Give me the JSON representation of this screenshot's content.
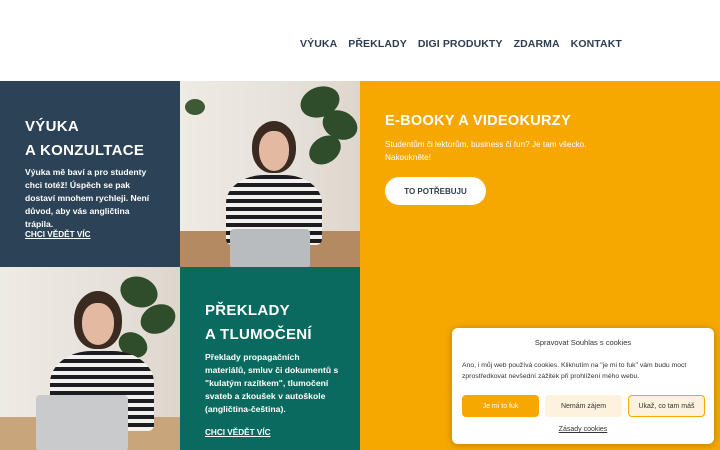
{
  "nav": {
    "items": [
      "VÝUKA",
      "PŘEKLADY",
      "DIGI PRODUKTY",
      "ZDARMA",
      "KONTAKT"
    ]
  },
  "tiles": {
    "teaching": {
      "title_line1": "VÝUKA",
      "title_line2": "A KONZULTACE",
      "text": "Výuka mě baví a pro studenty chci totéž! Úspěch se pak dostaví mnohem rychleji. Není důvod, aby vás angličtina trápila.",
      "link": "CHCI VĚDĚT VÍC"
    },
    "ebooks": {
      "title": "E-BOOKY A VIDEOKURZY",
      "text": "Studentům či lektorům, business či fun? Je tam všecko. Nakoukněte!",
      "button": "TO POTŘEBUJU"
    },
    "translations": {
      "title_line1": "PŘEKLADY",
      "title_line2": "A TLUMOČENÍ",
      "text": "Překlady propagačních materiálů, smluv či dokumentů s \"kulatým razítkem\", tlumočení svateb a zkoušek v autoškole (angličtina-čeština).",
      "link": "CHCI VĚDĚT VÍC"
    }
  },
  "cookie": {
    "title": "Spravovat Souhlas s cookies",
    "body": "Ano, i můj web používá cookies. Kliknutím na \"je mi to fuk\" vám budu moct zprostředkovat nevšední zážitek při prohlížení mého webu.",
    "accept": "Je mi to fuk",
    "deny": "Nemám zájem",
    "prefs": "Ukaž, co tam máš",
    "policy": "Zásady cookies"
  },
  "colors": {
    "dark_blue": "#2c4357",
    "orange": "#f6a800",
    "green": "#0b6a5f"
  }
}
